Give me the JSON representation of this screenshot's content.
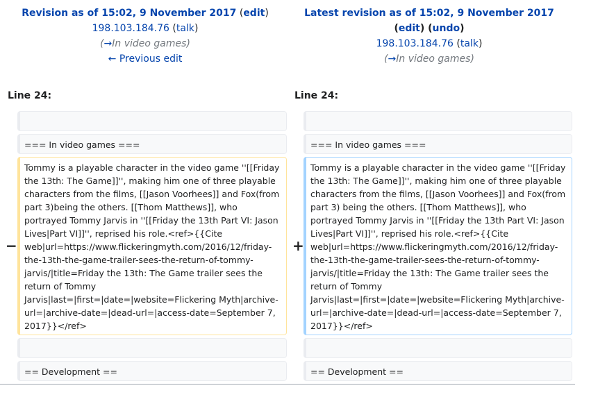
{
  "left_header": {
    "title": "Revision as of 15:02, 9 November 2017",
    "edit_label": "edit",
    "user": "198.103.184.76",
    "talk_label": "talk",
    "comment_arrow": "→",
    "comment_text": "In video games",
    "prev_edit": "← Previous edit"
  },
  "right_header": {
    "title": "Latest revision as of 15:02, 9 November 2017",
    "edit_label": "edit",
    "undo_label": "undo",
    "user": "198.103.184.76",
    "talk_label": "talk",
    "comment_arrow": "→",
    "comment_text": "In video games"
  },
  "diff": {
    "left_line": "Line 24:",
    "right_line": "Line 24:",
    "context_heading": "=== In video games ===",
    "removed_marker": "−",
    "added_marker": "+",
    "removed_text": "Tommy is a playable character in the video game ''[[Friday the 13th: The Game]]'', making him one of three playable characters from the films, [[Jason Voorhees]] and Fox(from part 3)being the others. [[Thom Matthews]], who portrayed Tommy Jarvis in ''[[Friday the 13th Part VI: Jason Lives|Part VI]]'', reprised his role.<ref>{{Cite web|url=https://www.flickeringmyth.com/2016/12/friday-the-13th-the-game-trailer-sees-the-return-of-tommy-jarvis/|title=Friday the 13th: The Game trailer sees the return of Tommy Jarvis|last=|first=|date=|website=Flickering Myth|archive-url=|archive-date=|dead-url=|access-date=September 7, 2017}}</ref>",
    "added_text": "Tommy is a playable character in the video game ''[[Friday the 13th: The Game]]'', making him one of three playable characters from the films, [[Jason Voorhees]] and Fox(from part 3) being the others. [[Thom Matthews]], who portrayed Tommy Jarvis in ''[[Friday the 13th Part VI: Jason Lives|Part VI]]'', reprised his role.<ref>{{Cite web|url=https://www.flickeringmyth.com/2016/12/friday-the-13th-the-game-trailer-sees-the-return-of-tommy-jarvis/|title=Friday the 13th: The Game trailer sees the return of Tommy Jarvis|last=|first=|date=|website=Flickering Myth|archive-url=|archive-date=|dead-url=|access-date=September 7, 2017}}</ref>",
    "context_dev": "== Development =="
  }
}
